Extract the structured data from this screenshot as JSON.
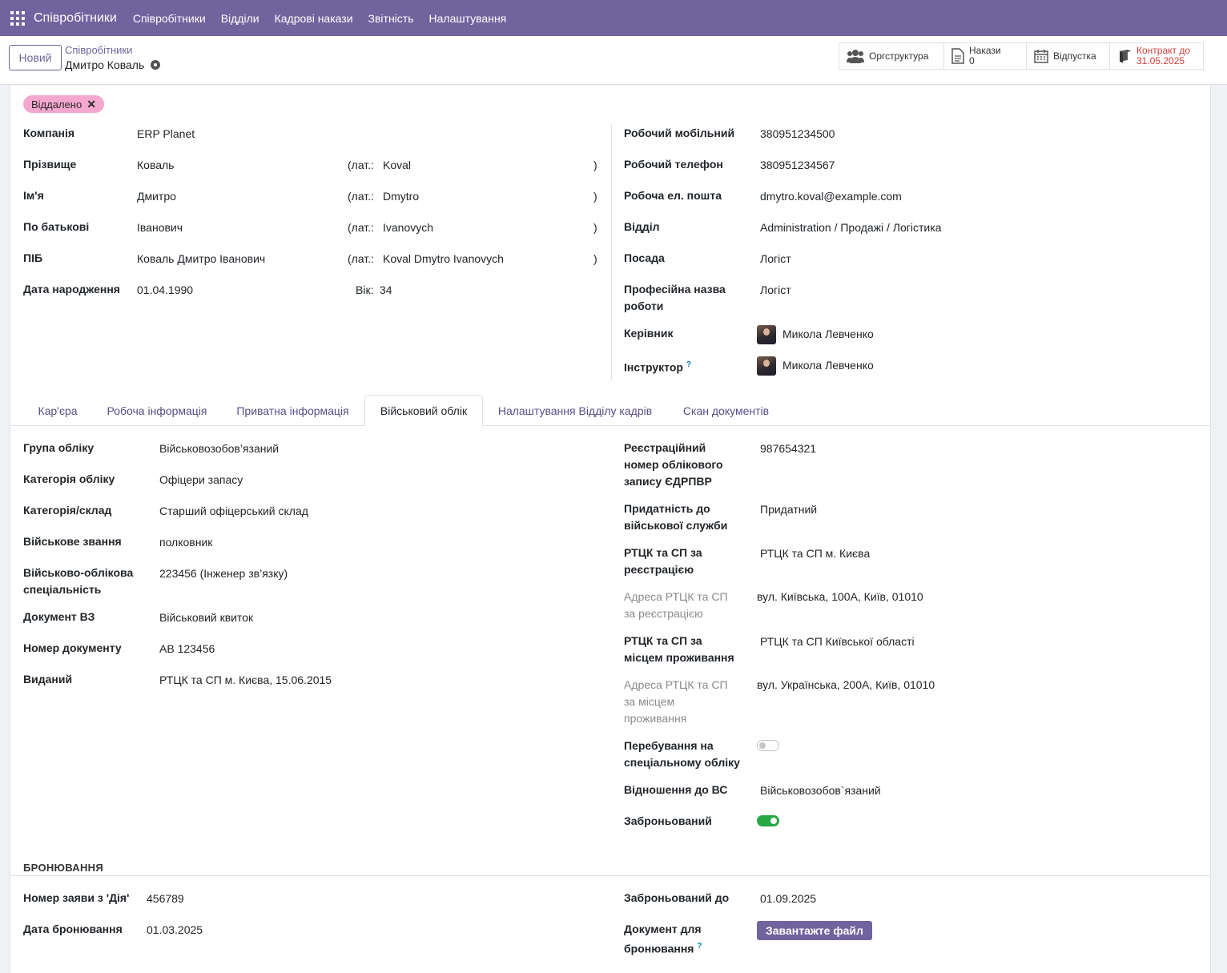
{
  "navbar": {
    "brand": "Співробітники",
    "menu": [
      "Співробітники",
      "Відділи",
      "Кадрові накази",
      "Звітність",
      "Налаштування"
    ]
  },
  "control_panel": {
    "new_button": "Новий",
    "breadcrumb_parent": "Співробітники",
    "breadcrumb_current": "Дмитро Коваль",
    "stat_orgchart": "Оргструктура",
    "stat_orders_label": "Накази",
    "stat_orders_count": "0",
    "stat_leave": "Відпустка",
    "stat_contract_label": "Контракт до",
    "stat_contract_date": "31.05.2025"
  },
  "tag": {
    "label": "Віддалено",
    "color": "#f4a7cf"
  },
  "header_left": {
    "company_label": "Компанія",
    "company": "ERP Planet",
    "surname_label": "Прізвище",
    "surname": "Коваль",
    "surname_lat": "Koval",
    "name_label": "Ім'я",
    "name": "Дмитро",
    "name_lat": "Dmytro",
    "patronymic_label": "По батькові",
    "patronymic": "Іванович",
    "patronymic_lat": "Ivanovych",
    "fullname_label": "ПІБ",
    "fullname": "Коваль Дмитро Іванович",
    "fullname_lat": "Koval Dmytro Ivanovych",
    "lat_prefix": "(лат.:",
    "lat_suffix": ")",
    "birthdate_label": "Дата народження",
    "birthdate": "01.04.1990",
    "age_label": "Вік:",
    "age": "34"
  },
  "header_right": {
    "mobile_label": "Робочий мобільний",
    "mobile": "380951234500",
    "phone_label": "Робочий телефон",
    "phone": "380951234567",
    "email_label": "Робоча ел. пошта",
    "email": "dmytro.koval@example.com",
    "department_label": "Відділ",
    "department": "Administration / Продажі / Логістика",
    "position_label": "Посада",
    "position": "Логіст",
    "job_title_label_1": "Професійна назва",
    "job_title_label_2": "роботи",
    "job_title": "Логіст",
    "manager_label": "Керівник",
    "manager": "Микола Левченко",
    "coach_label": "Інструктор",
    "coach_help": "?",
    "coach": "Микола Левченко"
  },
  "tabs": [
    "Кар'єра",
    "Робоча інформація",
    "Приватна інформація",
    "Військовий облік",
    "Налаштування Відділу кадрів",
    "Скан документів"
  ],
  "active_tab": "Військовий облік",
  "military_left": {
    "group_label": "Група обліку",
    "group": "Військовозобов’язаний",
    "category_label": "Категорія обліку",
    "category": "Офіцери запасу",
    "staff_label": "Категорія/склад",
    "staff": "Старший офіцерський склад",
    "rank_label": "Військове звання",
    "rank": "полковник",
    "specialty_label_1": "Військово-облікова",
    "specialty_label_2": "спеціальність",
    "specialty": "223456 (Інженер зв’язку)",
    "doc_label": "Документ ВЗ",
    "doc": "Військовий квиток",
    "doc_number_label": "Номер документу",
    "doc_number": "АВ 123456",
    "issued_label": "Виданий",
    "issued": "РТЦК та СП м. Києва, 15.06.2015"
  },
  "military_right": {
    "reg_label_1": "Реєстраційний",
    "reg_label_2": "номер облікового",
    "reg_label_3": "запису ЄДРПВР",
    "reg": "987654321",
    "fitness_label_1": "Придатність до",
    "fitness_label_2": "військової служби",
    "fitness": "Придатний",
    "rtck_reg_label_1": "РТЦК та СП за",
    "rtck_reg_label_2": "реєстрацією",
    "rtck_reg": "РТЦК та СП м. Києва",
    "rtck_reg_addr_label_1": "Адреса РТЦК та СП",
    "rtck_reg_addr_label_2": "за реєстрацією",
    "rtck_reg_addr": "вул. Київська, 100А, Київ, 01010",
    "rtck_res_label_1": "РТЦК та СП за",
    "rtck_res_label_2": "місцем проживання",
    "rtck_res": "РТЦК та СП Київської області",
    "rtck_res_addr_label_1": "Адреса РТЦК та СП",
    "rtck_res_addr_label_2": "за місцем",
    "rtck_res_addr_label_3": "проживання",
    "rtck_res_addr": "вул. Українська, 200А, Київ, 01010",
    "special_label_1": "Перебування на",
    "special_label_2": "спеціальному обліку",
    "special": false,
    "relation_label": "Відношення до ВС",
    "relation": "Військовозобов`язаний",
    "reserved_label": "Заброньований",
    "reserved": true
  },
  "reservation": {
    "section_title": "БРОНЮВАННЯ",
    "diia_label": "Номер заяви з 'Дія'",
    "diia": "456789",
    "date_label": "Дата бронювання",
    "date": "01.03.2025",
    "until_label": "Заброньований до",
    "until": "01.09.2025",
    "doc_label_1": "Документ для",
    "doc_label_2": "бронювання",
    "doc_help": "?",
    "upload_button": "Завантажте файл"
  },
  "colors": {
    "brand": "#71639e",
    "tag": "#f4a7cf",
    "toggle_on": "#28a745",
    "contract": "#d23f3a"
  }
}
